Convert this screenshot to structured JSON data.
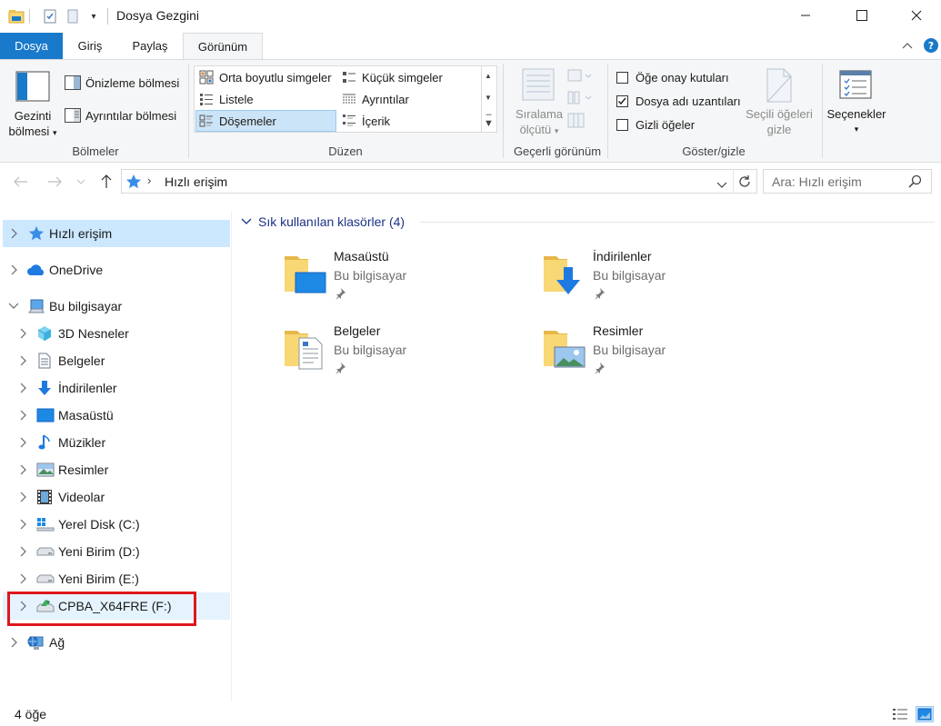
{
  "window": {
    "title": "Dosya Gezgini"
  },
  "tabs": [
    {
      "label": "Dosya"
    },
    {
      "label": "Giriş"
    },
    {
      "label": "Paylaş"
    },
    {
      "label": "Görünüm"
    }
  ],
  "ribbon": {
    "panes": {
      "navigation_pane": "Gezinti bölmesi",
      "navigation_pane_line1": "Gezinti",
      "navigation_pane_line2": "bölmesi",
      "preview_pane": "Önizleme bölmesi",
      "details_pane": "Ayrıntılar bölmesi",
      "group_label": "Bölmeler"
    },
    "layout": {
      "items": [
        {
          "label": "Orta boyutlu simgeler"
        },
        {
          "label": "Küçük simgeler"
        },
        {
          "label": "Listele"
        },
        {
          "label": "Ayrıntılar"
        },
        {
          "label": "Döşemeler",
          "selected": true
        },
        {
          "label": "İçerik"
        }
      ],
      "group_label": "Düzen"
    },
    "current_view": {
      "sort_by_line1": "Sıralama",
      "sort_by_line2": "ölçütü",
      "group_label": "Geçerli görünüm"
    },
    "show_hide": {
      "item_checkboxes": {
        "label": "Öğe onay kutuları",
        "checked": false
      },
      "file_extensions": {
        "label": "Dosya adı uzantıları",
        "checked": true
      },
      "hidden_items": {
        "label": "Gizli öğeler",
        "checked": false
      },
      "hide_selected_line1": "Seçili öğeleri",
      "hide_selected_line2": "gizle",
      "group_label": "Göster/gizle"
    },
    "options_label": "Seçenekler"
  },
  "address": {
    "location": "Hızlı erişim",
    "search_placeholder": "Ara: Hızlı erişim"
  },
  "sidebar": {
    "items": [
      {
        "label": "Hızlı erişim",
        "icon": "star-icon"
      },
      {
        "label": "OneDrive",
        "icon": "cloud-icon"
      },
      {
        "label": "Bu bilgisayar",
        "icon": "computer-icon"
      },
      {
        "label": "3D Nesneler",
        "icon": "cube-icon"
      },
      {
        "label": "Belgeler",
        "icon": "document-icon"
      },
      {
        "label": "İndirilenler",
        "icon": "download-arrow-icon"
      },
      {
        "label": "Masaüstü",
        "icon": "desktop-icon"
      },
      {
        "label": "Müzikler",
        "icon": "music-note-icon"
      },
      {
        "label": "Resimler",
        "icon": "picture-icon"
      },
      {
        "label": "Videolar",
        "icon": "film-icon"
      },
      {
        "label": "Yerel Disk (C:)",
        "icon": "windows-drive-icon"
      },
      {
        "label": "Yeni Birim (D:)",
        "icon": "drive-icon"
      },
      {
        "label": "Yeni Birim (E:)",
        "icon": "drive-icon"
      },
      {
        "label": "CPBA_X64FRE (F:)",
        "icon": "install-drive-icon"
      },
      {
        "label": "Ağ",
        "icon": "network-icon"
      }
    ]
  },
  "content": {
    "section_title": "Sık kullanılan klasörler (4)",
    "folders": [
      {
        "name": "Masaüstü",
        "location": "Bu bilgisayar"
      },
      {
        "name": "İndirilenler",
        "location": "Bu bilgisayar"
      },
      {
        "name": "Belgeler",
        "location": "Bu bilgisayar"
      },
      {
        "name": "Resimler",
        "location": "Bu bilgisayar"
      }
    ]
  },
  "status": {
    "item_count": "4 öğe"
  },
  "colors": {
    "accent": "#1979ca",
    "selection": "#cce8ff",
    "highlight_border": "#e0161e",
    "folder_yellow": "#f8d775"
  }
}
